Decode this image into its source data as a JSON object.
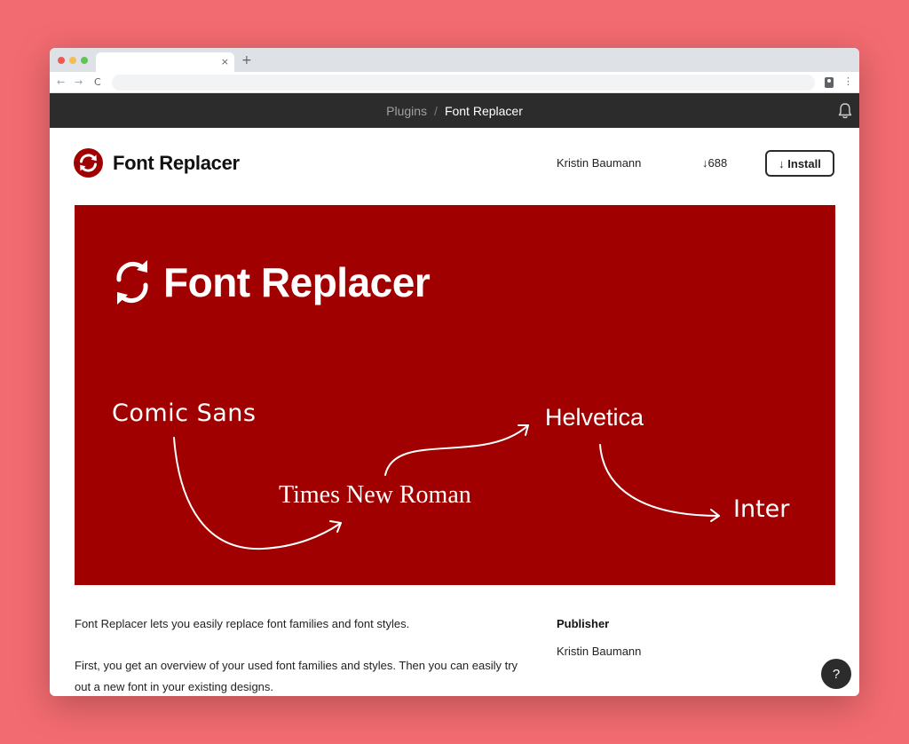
{
  "browser": {
    "tab_close_glyph": "×",
    "new_tab_glyph": "+",
    "back_glyph": "←",
    "forward_glyph": "→",
    "reload_glyph": "C",
    "menu_glyph": "⋮"
  },
  "breadcrumb": {
    "root": "Plugins",
    "separator": "/",
    "current": "Font Replacer"
  },
  "plugin": {
    "title": "Font Replacer",
    "author": "Kristin Baumann",
    "downloads": "↓688",
    "install_label": "↓ Install",
    "brand_color": "#a10000"
  },
  "banner": {
    "title": "Font Replacer",
    "fonts": {
      "comic": "Comic Sans",
      "times": "Times New Roman",
      "helvetica": "Helvetica",
      "inter": "Inter"
    }
  },
  "description": {
    "paragraph_1": "Font Replacer lets you easily replace font families and font styles.",
    "paragraph_2": "First, you get an overview of your used font families and styles. Then you can easily try out a new font in your existing designs."
  },
  "sidebar": {
    "publisher_label": "Publisher",
    "publisher_value": "Kristin Baumann"
  },
  "help": {
    "label": "?"
  },
  "icons": {
    "bell": "bell-icon",
    "logo": "refresh-logo-icon",
    "profile": "profile-icon"
  }
}
